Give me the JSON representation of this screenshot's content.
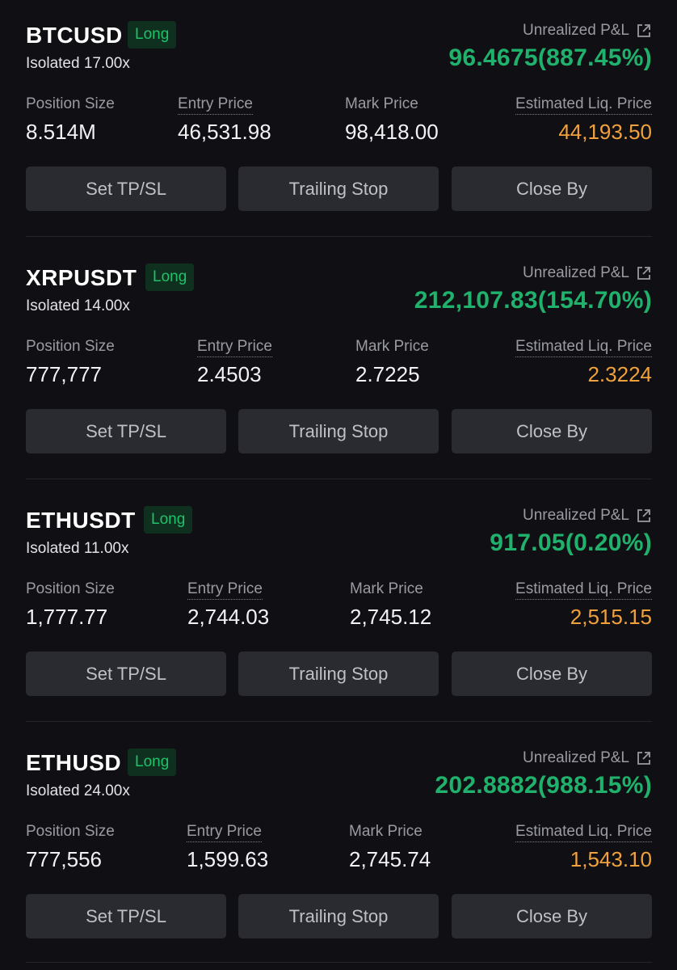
{
  "positions": [
    {
      "symbol": "BTCUSD",
      "side": "Long",
      "leverage": "Isolated 17.00x",
      "pnl_label": "Unrealized P&L",
      "pnl_value": "96.4675(887.45%)",
      "fields": {
        "position_size_label": "Position Size",
        "position_size": "8.514M",
        "entry_price_label": "Entry Price",
        "entry_price": "46,531.98",
        "mark_price_label": "Mark Price",
        "mark_price": "98,418.00",
        "liq_price_label": "Estimated Liq. Price",
        "liq_price": "44,193.50"
      },
      "buttons": [
        "Set TP/SL",
        "Trailing Stop",
        "Close By"
      ]
    },
    {
      "symbol": "XRPUSDT",
      "side": "Long",
      "leverage": "Isolated 14.00x",
      "pnl_label": "Unrealized P&L",
      "pnl_value": "212,107.83(154.70%)",
      "fields": {
        "position_size_label": "Position Size",
        "position_size": "777,777",
        "entry_price_label": "Entry Price",
        "entry_price": "2.4503",
        "mark_price_label": "Mark Price",
        "mark_price": "2.7225",
        "liq_price_label": "Estimated Liq. Price",
        "liq_price": "2.3224"
      },
      "buttons": [
        "Set TP/SL",
        "Trailing Stop",
        "Close By"
      ]
    },
    {
      "symbol": "ETHUSDT",
      "side": "Long",
      "leverage": "Isolated 11.00x",
      "pnl_label": "Unrealized P&L",
      "pnl_value": "917.05(0.20%)",
      "fields": {
        "position_size_label": "Position Size",
        "position_size": "1,777.77",
        "entry_price_label": "Entry Price",
        "entry_price": "2,744.03",
        "mark_price_label": "Mark Price",
        "mark_price": "2,745.12",
        "liq_price_label": "Estimated Liq. Price",
        "liq_price": "2,515.15"
      },
      "buttons": [
        "Set TP/SL",
        "Trailing Stop",
        "Close By"
      ]
    },
    {
      "symbol": "ETHUSD",
      "side": "Long",
      "leverage": "Isolated 24.00x",
      "pnl_label": "Unrealized P&L",
      "pnl_value": "202.8882(988.15%)",
      "fields": {
        "position_size_label": "Position Size",
        "position_size": "777,556",
        "entry_price_label": "Entry Price",
        "entry_price": "1,599.63",
        "mark_price_label": "Mark Price",
        "mark_price": "2,745.74",
        "liq_price_label": "Estimated Liq. Price",
        "liq_price": "1,543.10"
      },
      "buttons": [
        "Set TP/SL",
        "Trailing Stop",
        "Close By"
      ]
    }
  ],
  "colors": {
    "background": "#101014",
    "profit_green": "#20b26c",
    "liq_orange": "#f0a13b",
    "badge_bg": "#10301f",
    "button_bg": "#2a2b31"
  },
  "icons": {
    "pnl_share": "external-link-icon"
  }
}
